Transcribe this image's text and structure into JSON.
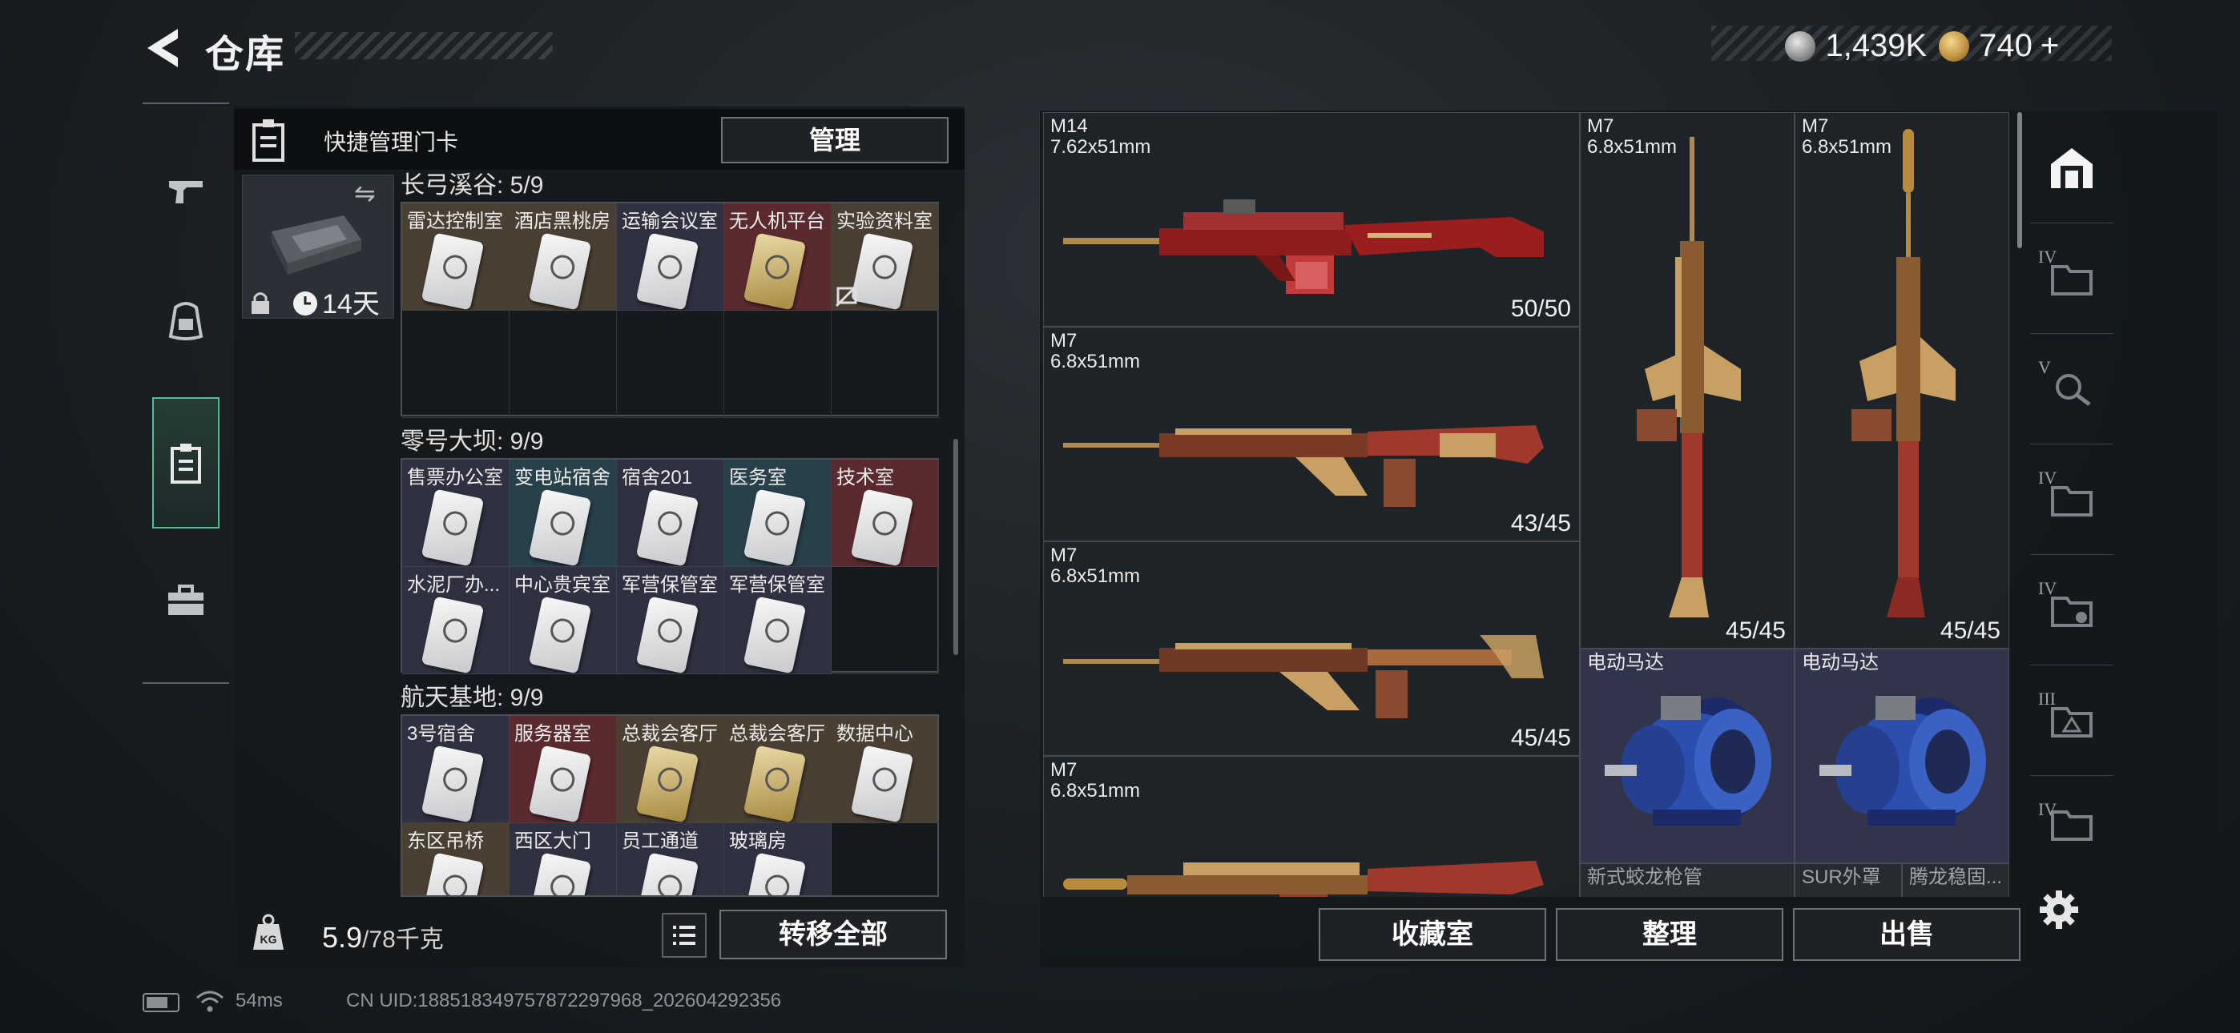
{
  "header": {
    "title": "仓库",
    "currency": [
      {
        "icon": "silver-coin-icon",
        "value": "1,439K"
      },
      {
        "icon": "gold-triangle-coin-icon",
        "value": "740",
        "add_label": "+"
      }
    ]
  },
  "nav": {
    "items": [
      {
        "name": "weapon-tab",
        "icon": "pistol-icon"
      },
      {
        "name": "equipment-tab",
        "icon": "backpack-icon"
      },
      {
        "name": "keycard-tab",
        "icon": "keycard-holder-icon",
        "active": true
      },
      {
        "name": "toolbox-tab",
        "icon": "briefcase-icon"
      }
    ]
  },
  "quick_manage": {
    "label": "快捷管理门卡",
    "manage_button": "管理",
    "bag_days": "14天"
  },
  "sections": [
    {
      "title": "长弓溪谷: 5/9",
      "cards": [
        {
          "label": "雷达控制室",
          "style": "silver",
          "bg": "#4a3f33"
        },
        {
          "label": "酒店黑桃房",
          "style": "silver",
          "bg": "#4a3f33"
        },
        {
          "label": "运输会议室",
          "style": "silver",
          "bg": "#2f3140"
        },
        {
          "label": "无人机平台",
          "style": "gold",
          "bg": "#5a2a2e"
        },
        {
          "label": "实验资料室",
          "style": "silver",
          "bg": "#4a3f33"
        }
      ]
    },
    {
      "title": "零号大坝: 9/9",
      "cards": [
        {
          "label": "售票办公室",
          "style": "silver",
          "bg": "#2f3140"
        },
        {
          "label": "变电站宿舍",
          "style": "silver",
          "bg": "#28404a"
        },
        {
          "label": "宿舍201",
          "style": "silver",
          "bg": "#2f3140"
        },
        {
          "label": "医务室",
          "style": "silver",
          "bg": "#28404a"
        },
        {
          "label": "技术室",
          "style": "silver",
          "bg": "#5a2a2e"
        },
        {
          "label": "水泥厂办...",
          "style": "silver",
          "bg": "#2f3140"
        },
        {
          "label": "中心贵宾室",
          "style": "silver",
          "bg": "#2f3140"
        },
        {
          "label": "军营保管室",
          "style": "silver",
          "bg": "#2f3140"
        },
        {
          "label": "军营保管室",
          "style": "silver",
          "bg": "#2f3140"
        }
      ]
    },
    {
      "title": "航天基地: 9/9",
      "cards": [
        {
          "label": "3号宿舍",
          "style": "silver",
          "bg": "#2f3140"
        },
        {
          "label": "服务器室",
          "style": "silver",
          "bg": "#5a2a2e"
        },
        {
          "label": "总裁会客厅",
          "style": "gold",
          "bg": "#4a3f33"
        },
        {
          "label": "总裁会客厅",
          "style": "gold",
          "bg": "#4a3f33"
        },
        {
          "label": "数据中心",
          "style": "silver",
          "bg": "#4a3f33"
        },
        {
          "label": "东区吊桥",
          "style": "silver",
          "bg": "#4a3f33"
        },
        {
          "label": "西区大门",
          "style": "silver",
          "bg": "#2f3140"
        },
        {
          "label": "员工通道",
          "style": "silver",
          "bg": "#2f3140"
        },
        {
          "label": "玻璃房",
          "style": "silver",
          "bg": "#2f3140"
        }
      ]
    }
  ],
  "capacity": {
    "value": "5.9",
    "max": "/78千克",
    "transfer_all": "转移全部"
  },
  "stash_items": [
    {
      "name": "M14",
      "caliber": "7.62x51mm",
      "count": "50/50"
    },
    {
      "name": "M7",
      "caliber": "6.8x51mm",
      "count": "43/45"
    },
    {
      "name": "M7",
      "caliber": "6.8x51mm",
      "count": "45/45"
    },
    {
      "name": "M7",
      "caliber": "6.8x51mm",
      "count": ""
    },
    {
      "name": "M7",
      "caliber": "6.8x51mm",
      "count": "45/45"
    },
    {
      "name": "M7",
      "caliber": "6.8x51mm",
      "count": "45/45"
    },
    {
      "name": "电动马达",
      "caliber": "",
      "count": ""
    },
    {
      "name": "电动马达",
      "caliber": "",
      "count": ""
    }
  ],
  "bottom_row_labels": [
    "新式蛟龙枪管",
    "SUR外罩",
    "腾龙稳固..."
  ],
  "side_tabs": [
    {
      "icon": "home-vault-icon",
      "tier": ""
    },
    {
      "icon": "folder-icon",
      "tier": "IV"
    },
    {
      "icon": "magnifier-icon",
      "tier": "V"
    },
    {
      "icon": "folder-icon",
      "tier": "IV"
    },
    {
      "icon": "gear-folder-icon",
      "tier": "IV"
    },
    {
      "icon": "warning-folder-icon",
      "tier": "III"
    },
    {
      "icon": "folder-icon",
      "tier": "IV"
    }
  ],
  "actions": {
    "collection": "收藏室",
    "sort": "整理",
    "sell": "出售"
  },
  "footer": {
    "ping": "54ms",
    "uid": "CN UID:1885183497578722979​68_202604292356"
  },
  "colors": {
    "accent_green": "#4fbf8f",
    "weapon_red": "#a01e1e",
    "weapon_gold": "#c9a063",
    "motor_blue": "#2b4fae"
  }
}
